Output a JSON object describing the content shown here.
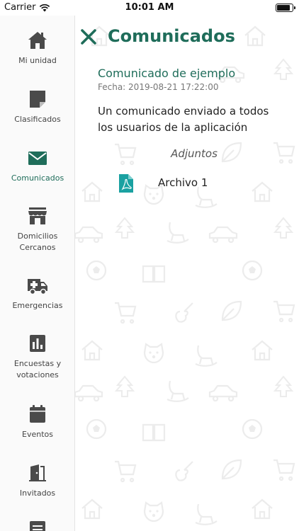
{
  "status": {
    "carrier": "Carrier",
    "time": "10:01 AM",
    "battery_level": 0.9
  },
  "colors": {
    "accent": "#1f6d5a",
    "sidebar_icon": "#4a4a4a",
    "pattern": "#eeeeee"
  },
  "sidebar": {
    "items": [
      {
        "label": "Mi unidad",
        "icon": "home-icon"
      },
      {
        "label": "Clasificados",
        "icon": "sticky-note-icon"
      },
      {
        "label": "Comunicados",
        "icon": "envelope-icon",
        "active": true
      },
      {
        "label": "Domicilios Cercanos",
        "icon": "store-icon"
      },
      {
        "label": "Emergencias",
        "icon": "ambulance-icon"
      },
      {
        "label": "Encuestas y votaciones",
        "icon": "bar-chart-icon"
      },
      {
        "label": "Eventos",
        "icon": "calendar-icon"
      },
      {
        "label": "Invitados",
        "icon": "door-icon"
      },
      {
        "label": "",
        "icon": "document-icon"
      }
    ]
  },
  "header": {
    "title": "Comunicados",
    "close_icon": "close-icon"
  },
  "message": {
    "title": "Comunicado de ejemplo",
    "date": "Fecha: 2019-08-21 17:22:00",
    "body": "Un comunicado enviado a todos los usuarios de la aplicación"
  },
  "attachments": {
    "heading": "Adjuntos",
    "items": [
      {
        "name": "Archivo 1",
        "icon": "pdf-icon"
      }
    ]
  }
}
